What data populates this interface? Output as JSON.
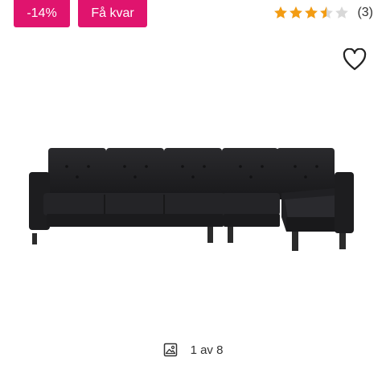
{
  "badges": {
    "discount": "-14%",
    "stock": "Få kvar"
  },
  "rating": {
    "value": 3.5,
    "max": 5,
    "count_label": "(3)",
    "filled_color": "#f39c12",
    "empty_color": "#d8d8d8"
  },
  "favorite": {
    "icon": "heart-outline-icon"
  },
  "product_image": {
    "alt": "Black sectional sofa with chaise"
  },
  "gallery": {
    "icon": "image-icon",
    "counter": "1 av 8"
  },
  "colors": {
    "badge": "#e0146e",
    "sofa": "#1e1e20"
  }
}
